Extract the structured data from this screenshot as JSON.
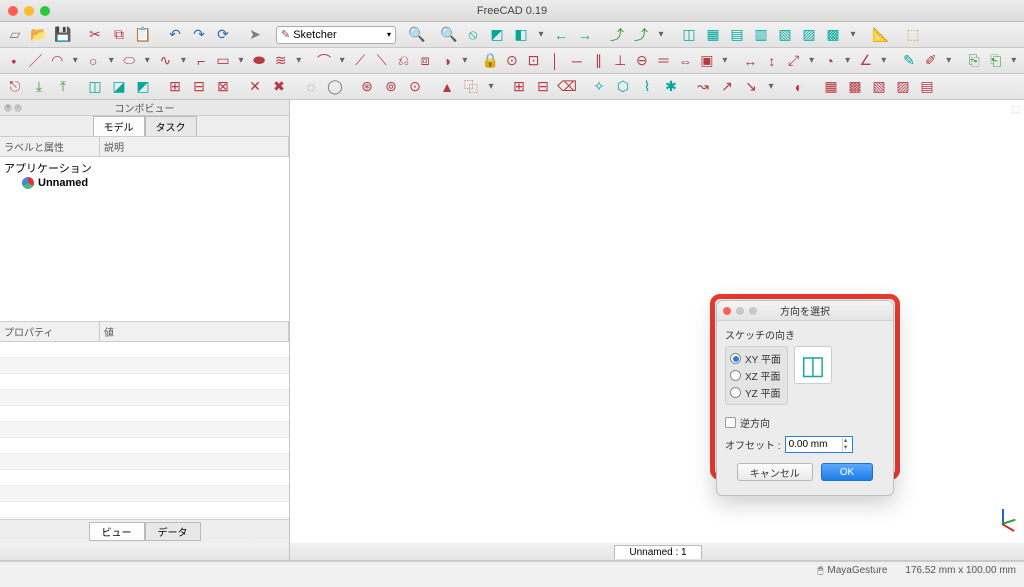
{
  "app": {
    "title": "FreeCAD 0.19"
  },
  "workbench": {
    "selected": "Sketcher"
  },
  "combo": {
    "panel_title": "コンボビュー",
    "tabs": [
      "モデル",
      "タスク"
    ],
    "active_tab": 0,
    "tree_headers": [
      "ラベルと属性",
      "説明"
    ],
    "tree": {
      "root": "アプリケーション",
      "children": [
        {
          "label": "Unnamed"
        }
      ]
    },
    "prop_headers": [
      "プロパティ",
      "値"
    ],
    "bottom_tabs": [
      "ビュー",
      "データ"
    ],
    "bottom_active": 0
  },
  "mdi": {
    "tabs": [
      "Unnamed : 1"
    ]
  },
  "status": {
    "nav_style": "MayaGesture",
    "dims": "176.52 mm x 100.00 mm"
  },
  "dialog": {
    "title": "方向を選択",
    "group": "スケッチの向き",
    "options": [
      "XY 平面",
      "XZ 平面",
      "YZ 平面"
    ],
    "selected": 0,
    "reverse_label": "逆方向",
    "reverse": false,
    "offset_label": "オフセット :",
    "offset_value": "0.00 mm",
    "cancel": "キャンセル",
    "ok": "OK"
  },
  "toolbar_rows": [
    [
      {
        "n": "new-file-icon",
        "g": "▱",
        "c": ""
      },
      {
        "n": "open-file-icon",
        "g": "📂",
        "c": "gold"
      },
      {
        "n": "save-icon",
        "g": "💾",
        "c": ""
      },
      {
        "sep": true
      },
      {
        "n": "cut-icon",
        "g": "✂",
        "c": "crimson"
      },
      {
        "n": "copy-icon",
        "g": "⧉",
        "c": "crimson"
      },
      {
        "n": "paste-icon",
        "g": "📋",
        "c": ""
      },
      {
        "sep": true
      },
      {
        "n": "undo-icon",
        "g": "↶",
        "c": "blue"
      },
      {
        "n": "redo-icon",
        "g": "↷",
        "c": "blue"
      },
      {
        "n": "refresh-icon",
        "g": "⟳",
        "c": "blue"
      },
      {
        "sep": true
      },
      {
        "n": "cursor-icon",
        "g": "➤",
        "c": ""
      },
      {
        "sep": true
      },
      {
        "workbench": true
      },
      {
        "sep": true
      },
      {
        "n": "zoom-fit-icon",
        "g": "🔍",
        "c": "teal"
      },
      {
        "sep": true
      },
      {
        "n": "zoom-in-icon",
        "g": "🔍",
        "c": "teal"
      },
      {
        "n": "view-nosel-icon",
        "g": "⦸",
        "c": "teal"
      },
      {
        "n": "view-sel-icon",
        "g": "◩",
        "c": "teal"
      },
      {
        "n": "draw-style-icon",
        "g": "◧",
        "c": "teal"
      },
      {
        "chev": true
      },
      {
        "n": "nav-left-icon",
        "g": "←",
        "c": "teal"
      },
      {
        "n": "nav-right-icon",
        "g": "→",
        "c": "teal"
      },
      {
        "sep": true
      },
      {
        "n": "link-go-icon",
        "g": "⤴",
        "c": "green"
      },
      {
        "n": "link-all-icon",
        "g": "⤴",
        "c": "green"
      },
      {
        "chev": true
      },
      {
        "sep": true
      },
      {
        "n": "iso-icon",
        "g": "◫",
        "c": "teal"
      },
      {
        "n": "front-icon",
        "g": "▦",
        "c": "teal"
      },
      {
        "n": "top-icon",
        "g": "▤",
        "c": "teal"
      },
      {
        "n": "right-icon",
        "g": "▥",
        "c": "teal"
      },
      {
        "n": "rear-icon",
        "g": "▧",
        "c": "teal"
      },
      {
        "n": "bottom-icon",
        "g": "▨",
        "c": "teal"
      },
      {
        "n": "left-icon",
        "g": "▩",
        "c": "teal"
      },
      {
        "chev": true
      },
      {
        "sep": true
      },
      {
        "n": "measure-icon",
        "g": "📐",
        "c": ""
      },
      {
        "sep": true
      },
      {
        "n": "part-box-icon",
        "g": "⬚",
        "c": "gold"
      }
    ],
    [
      {
        "n": "sk-point-icon",
        "g": "•",
        "c": "crimson"
      },
      {
        "n": "sk-line-icon",
        "g": "／",
        "c": "crimson"
      },
      {
        "n": "sk-arc-icon",
        "g": "◠",
        "c": "crimson"
      },
      {
        "chev": true
      },
      {
        "n": "sk-circle-icon",
        "g": "○",
        "c": "crimson"
      },
      {
        "chev": true
      },
      {
        "n": "sk-ellipse-icon",
        "g": "⬭",
        "c": "crimson"
      },
      {
        "chev": true
      },
      {
        "n": "sk-bspline-icon",
        "g": "∿",
        "c": "crimson"
      },
      {
        "chev": true
      },
      {
        "n": "sk-polyline-icon",
        "g": "⌐",
        "c": "crimson"
      },
      {
        "n": "sk-rect-icon",
        "g": "▭",
        "c": "crimson"
      },
      {
        "chev": true
      },
      {
        "n": "sk-slot-icon",
        "g": "⬬",
        "c": "crimson"
      },
      {
        "n": "sk-symb-icon",
        "g": "≋",
        "c": "crimson"
      },
      {
        "chev": true
      },
      {
        "sep": true
      },
      {
        "n": "sk-fillet-icon",
        "g": "⌒",
        "c": "crimson"
      },
      {
        "chev": true
      },
      {
        "n": "sk-trim-icon",
        "g": "⟋",
        "c": "crimson"
      },
      {
        "n": "sk-extend-icon",
        "g": "⟍",
        "c": "crimson"
      },
      {
        "n": "sk-extern-icon",
        "g": "⎌",
        "c": "crimson"
      },
      {
        "n": "sk-carbon-icon",
        "g": "⧈",
        "c": "crimson"
      },
      {
        "n": "sk-toggle-icon",
        "g": "◑",
        "c": "crimson"
      },
      {
        "chev": true
      },
      {
        "sep": true
      },
      {
        "n": "cons-lock-icon",
        "g": "🔒",
        "c": ""
      },
      {
        "n": "cons-coinc-icon",
        "g": "⊙",
        "c": "crimson"
      },
      {
        "n": "cons-ptobj-icon",
        "g": "⊡",
        "c": "crimson"
      },
      {
        "n": "cons-vert-icon",
        "g": "│",
        "c": "crimson"
      },
      {
        "n": "cons-horiz-icon",
        "g": "─",
        "c": "crimson"
      },
      {
        "n": "cons-para-icon",
        "g": "∥",
        "c": "crimson"
      },
      {
        "n": "cons-perp-icon",
        "g": "⊥",
        "c": "crimson"
      },
      {
        "n": "cons-tang-icon",
        "g": "⊖",
        "c": "crimson"
      },
      {
        "n": "cons-equal-icon",
        "g": "＝",
        "c": "crimson"
      },
      {
        "n": "cons-symm-icon",
        "g": "⇔",
        "c": "crimson"
      },
      {
        "n": "cons-block-icon",
        "g": "▣",
        "c": "crimson"
      },
      {
        "chev": true
      },
      {
        "sep": true
      },
      {
        "n": "dim-hlen-icon",
        "g": "↔",
        "c": "crimson"
      },
      {
        "n": "dim-vlen-icon",
        "g": "↕",
        "c": "crimson"
      },
      {
        "n": "dim-len-icon",
        "g": "⤢",
        "c": "crimson"
      },
      {
        "chev": true
      },
      {
        "n": "dim-rad-icon",
        "g": "◔",
        "c": "crimson"
      },
      {
        "chev": true
      },
      {
        "n": "dim-ang-icon",
        "g": "∠",
        "c": "crimson"
      },
      {
        "chev": true
      },
      {
        "sep": true
      },
      {
        "n": "sk-new-icon",
        "g": "✎",
        "c": "teal"
      },
      {
        "n": "sk-edit-icon",
        "g": "✐",
        "c": "crimson"
      },
      {
        "chev": true
      },
      {
        "sep": true
      },
      {
        "n": "make-link-icon",
        "g": "⎘",
        "c": "green"
      },
      {
        "n": "link-act-icon",
        "g": "⎗",
        "c": "green"
      },
      {
        "chev": true
      }
    ],
    [
      {
        "n": "sk-leave-icon",
        "g": "⎋",
        "c": "crimson"
      },
      {
        "n": "sk-view-icon",
        "g": "⤓",
        "c": "green"
      },
      {
        "n": "sk-section-icon",
        "g": "⤒",
        "c": "green"
      },
      {
        "sep": true
      },
      {
        "n": "sk-map-icon",
        "g": "◫",
        "c": "teal"
      },
      {
        "n": "sk-reorient-icon",
        "g": "◪",
        "c": "teal"
      },
      {
        "n": "sk-validate-icon",
        "g": "◩",
        "c": "teal"
      },
      {
        "sep": true
      },
      {
        "n": "sk-merge-icon",
        "g": "⊞",
        "c": "crimson"
      },
      {
        "n": "sk-mirror-icon",
        "g": "⊟",
        "c": "crimson"
      },
      {
        "n": "sk-del-icon",
        "g": "⊠",
        "c": "crimson"
      },
      {
        "sep": true
      },
      {
        "n": "sk-close-icon",
        "g": "✕",
        "c": "crimson"
      },
      {
        "n": "sk-stop-icon",
        "g": "✖",
        "c": "crimson"
      },
      {
        "sep": true
      },
      {
        "n": "sk-selcons-icon",
        "g": "◌",
        "c": ""
      },
      {
        "n": "sk-selassoc-icon",
        "g": "◯",
        "c": ""
      },
      {
        "sep": true
      },
      {
        "n": "sk-selorig-icon",
        "g": "⊛",
        "c": "crimson"
      },
      {
        "n": "sk-selva-icon",
        "g": "⊚",
        "c": "crimson"
      },
      {
        "n": "sk-selha-icon",
        "g": "⊙",
        "c": "crimson"
      },
      {
        "sep": true
      },
      {
        "n": "sk-sym-icon",
        "g": "▲",
        "c": "crimson"
      },
      {
        "n": "sk-clone-icon",
        "g": "⿻",
        "c": "crimson"
      },
      {
        "chev": true
      },
      {
        "sep": true
      },
      {
        "n": "sk-rectarr-icon",
        "g": "⊞",
        "c": "crimson"
      },
      {
        "n": "sk-rem-icon",
        "g": "⊟",
        "c": "crimson"
      },
      {
        "n": "sk-delcons-icon",
        "g": "⌫",
        "c": "crimson"
      },
      {
        "sep": true
      },
      {
        "n": "bsp-deg-icon",
        "g": "✧",
        "c": "teal"
      },
      {
        "n": "bsp-poly-icon",
        "g": "⬡",
        "c": "teal"
      },
      {
        "n": "bsp-comb-icon",
        "g": "⌇",
        "c": "teal"
      },
      {
        "n": "bsp-knot-icon",
        "g": "✱",
        "c": "teal"
      },
      {
        "sep": true
      },
      {
        "n": "bsp-conv-icon",
        "g": "↝",
        "c": "crimson"
      },
      {
        "n": "bsp-incdeg-icon",
        "g": "↗",
        "c": "crimson"
      },
      {
        "n": "bsp-decdeg-icon",
        "g": "↘",
        "c": "crimson"
      },
      {
        "chev": true
      },
      {
        "sep": true
      },
      {
        "n": "vs-switch-icon",
        "g": "◐",
        "c": "crimson"
      },
      {
        "sep": true
      },
      {
        "n": "vs-a-icon",
        "g": "▦",
        "c": "crimson"
      },
      {
        "n": "vs-b-icon",
        "g": "▩",
        "c": "crimson"
      },
      {
        "n": "vs-c-icon",
        "g": "▧",
        "c": "crimson"
      },
      {
        "n": "vs-d-icon",
        "g": "▨",
        "c": "crimson"
      },
      {
        "n": "vs-e-icon",
        "g": "▤",
        "c": "crimson"
      }
    ]
  ]
}
